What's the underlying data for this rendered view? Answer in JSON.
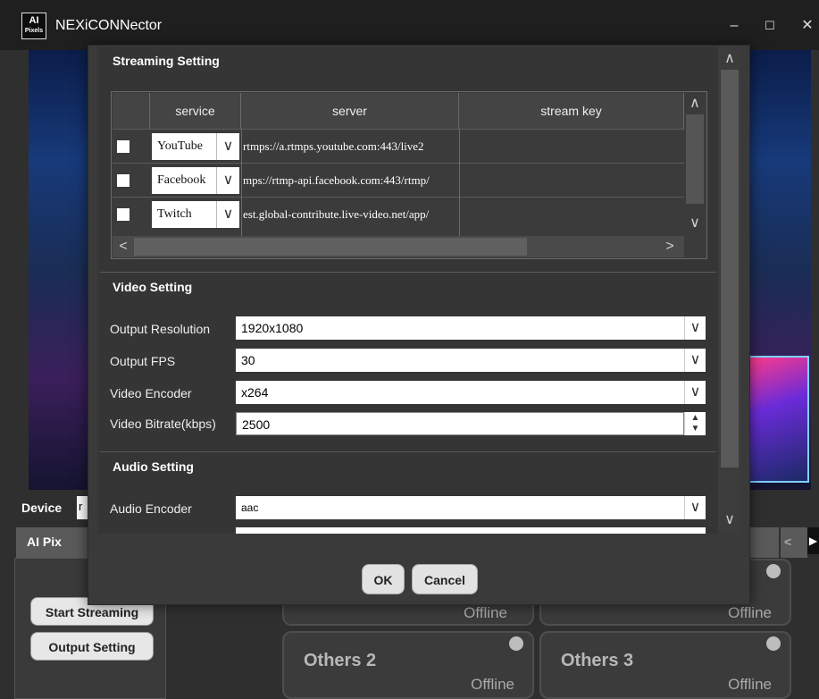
{
  "window": {
    "title": "NEXiCONNector",
    "logo_text": "AI",
    "logo_subtext": "Pixels",
    "minimize": "–",
    "maximize": "☐",
    "close": "✕"
  },
  "main": {
    "device_label": "Device",
    "device_value": "r",
    "tab_ai": "AI Pix",
    "start_streaming": "Start Streaming",
    "output_setting": "Output Setting",
    "cards": [
      {
        "name": "",
        "status": "Offline"
      },
      {
        "name": "",
        "status": "Offline"
      },
      {
        "name": "Others 2",
        "status": "Offline"
      },
      {
        "name": "Others 3",
        "status": "Offline"
      }
    ]
  },
  "dialog": {
    "streaming_title": "Streaming Setting",
    "columns": [
      "service",
      "server",
      "stream key"
    ],
    "rows": [
      {
        "service": "YouTube",
        "server": "rtmps://a.rtmps.youtube.com:443/live2",
        "key": ""
      },
      {
        "service": "Facebook",
        "server": "mps://rtmp-api.facebook.com:443/rtmp/",
        "key": ""
      },
      {
        "service": "Twitch",
        "server": "est.global-contribute.live-video.net/app/",
        "key": ""
      }
    ],
    "video_title": "Video Setting",
    "fields": [
      {
        "label": "Output Resolution",
        "value": "1920x1080"
      },
      {
        "label": "Output FPS",
        "value": "30"
      },
      {
        "label": "Video Encoder",
        "value": "x264"
      },
      {
        "label": "Video Bitrate(kbps)",
        "value": "2500"
      }
    ],
    "audio_title": "Audio Setting",
    "audio_encoder_label": "Audio Encoder",
    "audio_encoder_value": "aac",
    "ok": "OK",
    "cancel": "Cancel",
    "arrows": {
      "up": "∧",
      "down": "∨",
      "left": "<",
      "right": ">",
      "dropdown": "∨"
    }
  }
}
